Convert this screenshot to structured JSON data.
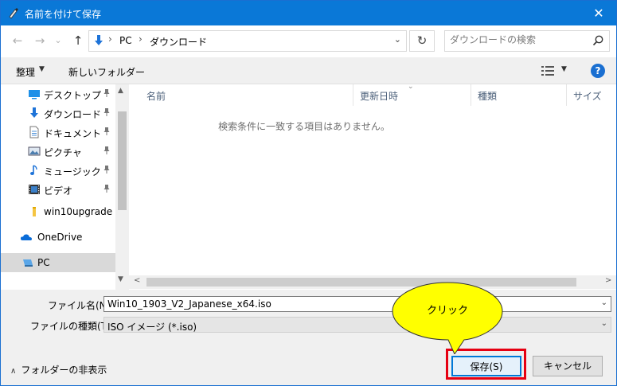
{
  "window": {
    "title": "名前を付けて保存",
    "close_glyph": "✕"
  },
  "nav": {
    "back_glyph": "←",
    "forward_glyph": "→",
    "recent_glyph": "⌄",
    "up_glyph": "↑"
  },
  "address": {
    "crumbs": [
      "PC",
      "ダウンロード"
    ],
    "separator": "›",
    "dropdown_glyph": "⌄",
    "refresh_glyph": "↻"
  },
  "search": {
    "placeholder": "ダウンロードの検索"
  },
  "toolbar": {
    "organize_label": "整理",
    "organize_caret": "▼",
    "new_folder_label": "新しいフォルダー",
    "view_caret": "▼",
    "help_label": "?"
  },
  "sidebar": {
    "items": [
      {
        "label": "デスクトップ",
        "icon": "desktop-icon",
        "pinned": true
      },
      {
        "label": "ダウンロード",
        "icon": "download-icon",
        "pinned": true
      },
      {
        "label": "ドキュメント",
        "icon": "document-icon",
        "pinned": true
      },
      {
        "label": "ピクチャ",
        "icon": "pictures-icon",
        "pinned": true
      },
      {
        "label": "ミュージック",
        "icon": "music-icon",
        "pinned": true
      },
      {
        "label": "ビデオ",
        "icon": "video-icon",
        "pinned": true
      },
      {
        "label": "win10upgrade",
        "icon": "folder-icon",
        "pinned": false
      },
      {
        "label": "OneDrive",
        "icon": "onedrive-icon",
        "pinned": false
      },
      {
        "label": "PC",
        "icon": "pc-icon",
        "pinned": false,
        "selected": true
      }
    ],
    "scroll_up_glyph": "▲",
    "scroll_down_glyph": "▼"
  },
  "content": {
    "columns": [
      "名前",
      "更新日時",
      "種類",
      "サイズ"
    ],
    "sort_glyph": "⌄",
    "empty_message": "検索条件に一致する項目はありません。",
    "scroll_left_glyph": "<",
    "scroll_right_glyph": ">"
  },
  "form": {
    "filename_label": "ファイル名(N):",
    "filename_value": "Win10_1903_V2_Japanese_x64.iso",
    "filetype_label": "ファイルの種類(T):",
    "filetype_value": "ISO イメージ (*.iso)",
    "dropdown_glyph": "⌄",
    "hide_folders_label": "フォルダーの非表示",
    "hide_folders_caret": "∧"
  },
  "buttons": {
    "save_label": "保存(S)",
    "cancel_label": "キャンセル"
  },
  "annotation": {
    "callout_text": "クリック",
    "callout_color": "#ffff00",
    "frame_color": "#e60012"
  },
  "colors": {
    "title_bar": "#0a78d7",
    "accent": "#0078d7"
  }
}
